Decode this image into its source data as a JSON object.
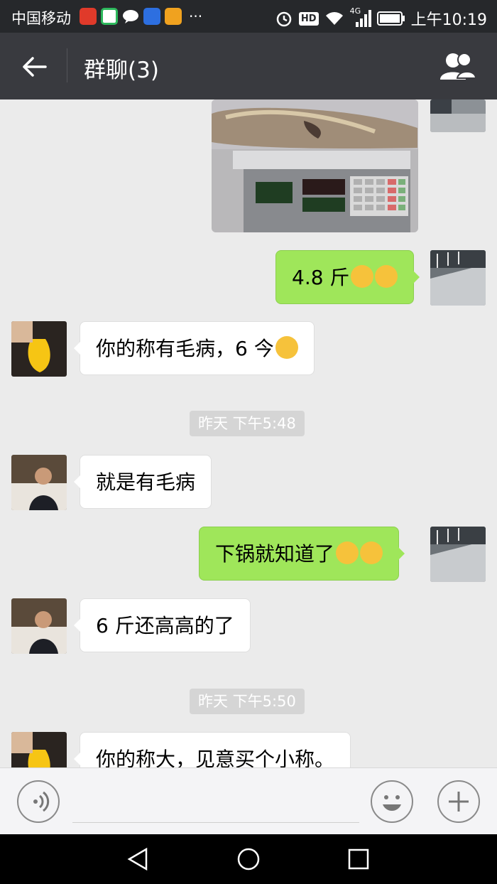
{
  "status_bar": {
    "carrier": "中国移动",
    "more": "···",
    "network": "4G",
    "time": "上午10:19",
    "icons": [
      "weibo-icon",
      "browser-icon",
      "message-icon",
      "baidu-icon",
      "mail-icon",
      "alarm-icon",
      "hd-icon",
      "wifi-icon",
      "signal-icon",
      "battery-icon"
    ]
  },
  "title_bar": {
    "title": "群聊(3)",
    "back_icon": "back-arrow-icon",
    "members_icon": "group-members-icon"
  },
  "messages": [
    {
      "side": "right",
      "type": "image",
      "content": "fish-on-scale-photo"
    },
    {
      "side": "right",
      "type": "text",
      "text": "4.8 斤",
      "emojis": [
        "grin-emoji",
        "grin-emoji"
      ]
    },
    {
      "side": "left",
      "type": "text",
      "text": "你的称有毛病，6 今",
      "emojis": [
        "thinking-emoji"
      ]
    },
    {
      "type": "time",
      "text": "昨天  下午5:48"
    },
    {
      "side": "left",
      "type": "text",
      "text": "就是有毛病"
    },
    {
      "side": "right",
      "type": "text",
      "text": "下锅就知道了",
      "emojis": [
        "thinking-emoji",
        "thinking-emoji"
      ]
    },
    {
      "side": "left",
      "type": "text",
      "text": "6 斤还高高的了"
    },
    {
      "type": "time",
      "text": "昨天  下午5:50"
    },
    {
      "side": "left",
      "type": "text",
      "text": "你的称大，见意买个小称。"
    }
  ],
  "input_bar": {
    "voice_icon": "voice-icon",
    "emoji_icon": "emoji-icon",
    "add_icon": "add-icon"
  },
  "nav_bar": {
    "buttons": [
      "back-nav-icon",
      "home-nav-icon",
      "recents-nav-icon"
    ]
  }
}
